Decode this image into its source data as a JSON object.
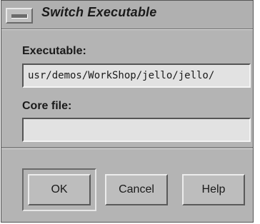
{
  "window": {
    "title": "Switch Executable",
    "menu_icon": "window-menu-icon"
  },
  "form": {
    "executable_label": "Executable:",
    "executable_value": "/usr/demos/WorkShop/jello/jello",
    "corefile_label": "Core file:",
    "corefile_value": ""
  },
  "buttons": {
    "ok": "OK",
    "cancel": "Cancel",
    "help": "Help"
  }
}
